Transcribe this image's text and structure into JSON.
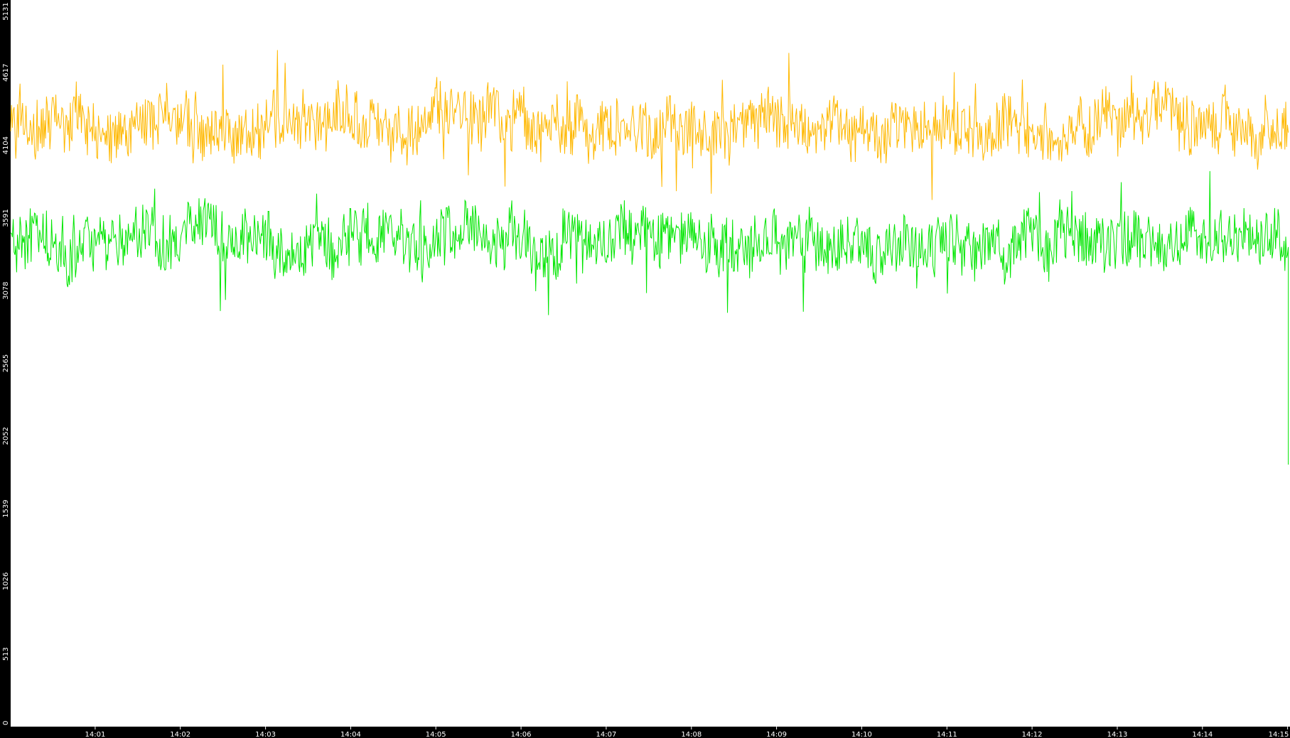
{
  "chart_data": {
    "type": "line",
    "title": "",
    "xlabel": "",
    "ylabel": "",
    "ylim": [
      0,
      5131
    ],
    "y_ticks": [
      "0",
      "513",
      "1026",
      "1539",
      "2052",
      "2565",
      "3078",
      "3591",
      "4104",
      "4617",
      "5131"
    ],
    "x_ticks": [
      "14:01",
      "14:02",
      "14:03",
      "14:04",
      "14:05",
      "14:06",
      "14:07",
      "14:08",
      "14:09",
      "14:10",
      "14:11",
      "14:12",
      "14:13",
      "14:14",
      "14:15"
    ],
    "x_range_minutes": [
      0,
      15
    ],
    "grid": false,
    "legend": "none",
    "background_color": "#ffffff",
    "frame_color": "#000000",
    "series": [
      {
        "color": "#ffb800",
        "mean": 4250,
        "spread": 170,
        "min": 3500,
        "max": 5131,
        "samples": 1500,
        "end_drop": 0
      },
      {
        "color": "#00e600",
        "mean": 3420,
        "spread": 170,
        "min": 2480,
        "max": 4150,
        "samples": 1500,
        "end_drop": 1850
      }
    ]
  }
}
